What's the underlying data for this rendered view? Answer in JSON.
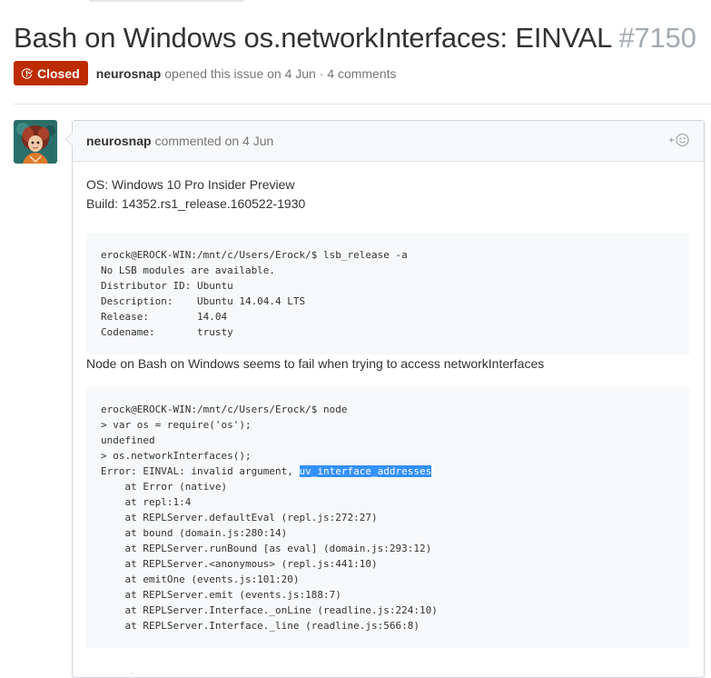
{
  "issue": {
    "title": "Bash on Windows os.networkInterfaces: EINVAL",
    "number": "#7150",
    "state": "Closed",
    "author": "neurosnap",
    "opened_text": "opened this issue on 4 Jun · 4 comments"
  },
  "comment": {
    "author": "neurosnap",
    "action": "commented on 4 Jun",
    "reaction_icon": "smiley-plus-icon",
    "body_line1": "OS: Windows 10 Pro Insider Preview",
    "body_line2": "Build: 14352.rs1_release.160522-1930",
    "code_block_1": "erock@EROCK-WIN:/mnt/c/Users/Erock/$ lsb_release -a\nNo LSB modules are available.\nDistributor ID: Ubuntu\nDescription:    Ubuntu 14.04.4 LTS\nRelease:        14.04\nCodename:       trusty",
    "paragraph_2": "Node on Bash on Windows seems to fail when trying to access networkInterfaces",
    "code_block_2_before": "erock@EROCK-WIN:/mnt/c/Users/Erock/$ node\n> var os = require('os');\nundefined\n> os.networkInterfaces();\nError: EINVAL: invalid argument, ",
    "code_block_2_selected": "uv_interface_addresses",
    "code_block_2_after": "\n    at Error (native)\n    at repl:1:4\n    at REPLServer.defaultEval (repl.js:272:27)\n    at bound (domain.js:280:14)\n    at REPLServer.runBound [as eval] (domain.js:293:12)\n    at REPLServer.<anonymous> (repl.js:441:10)\n    at emitOne (events.js:101:20)\n    at REPLServer.emit (events.js:188:7)\n    at REPLServer.Interface._onLine (readline.js:224:10)\n    at REPLServer.Interface._line (readline.js:566:8)"
  },
  "colors": {
    "closed_badge": "#bd2c00",
    "selection": "#3390ff",
    "code_background": "#f6f8fa"
  }
}
